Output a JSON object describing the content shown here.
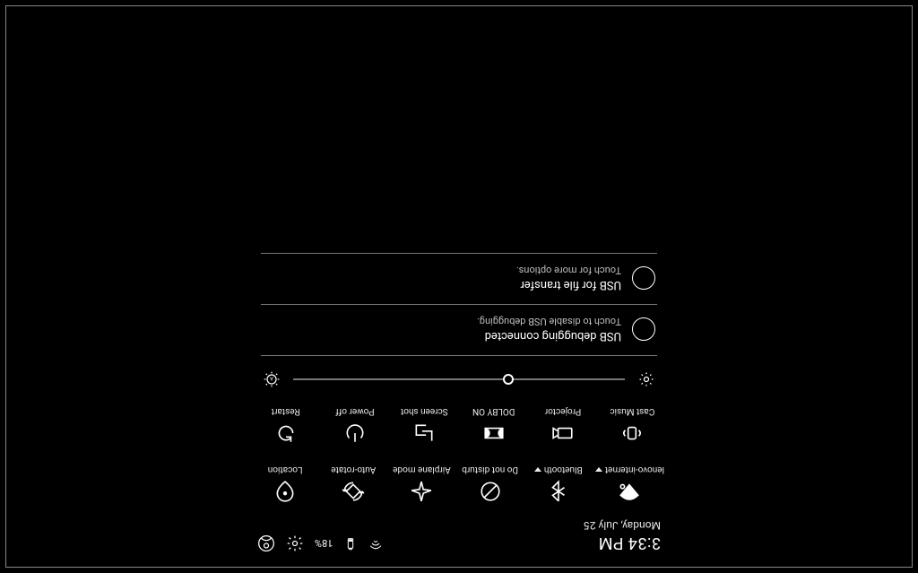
{
  "header": {
    "time": "3:34 PM",
    "date": "Monday, July 25",
    "battery": "18%"
  },
  "tiles_row1": [
    {
      "id": "wifi",
      "label": "lenovo-internet",
      "caret": true
    },
    {
      "id": "bluetooth",
      "label": "Bluetooth",
      "caret": true
    },
    {
      "id": "dnd",
      "label": "Do not disturb",
      "caret": false
    },
    {
      "id": "airplane",
      "label": "Airplane mode",
      "caret": false
    },
    {
      "id": "autorotate",
      "label": "Auto-rotate",
      "caret": false
    },
    {
      "id": "location",
      "label": "Location",
      "caret": false
    }
  ],
  "tiles_row2": [
    {
      "id": "castmusic",
      "label": "Cast Music",
      "caret": false
    },
    {
      "id": "projector",
      "label": "Projector",
      "caret": false
    },
    {
      "id": "dolby",
      "label": "DOLBY ON",
      "caret": false
    },
    {
      "id": "screenshot",
      "label": "Screen shot",
      "caret": false
    },
    {
      "id": "poweroff",
      "label": "Power off",
      "caret": false
    },
    {
      "id": "restart",
      "label": "Restart",
      "caret": false
    }
  ],
  "brightness": {
    "percent": 35
  },
  "notifications": [
    {
      "title": "USB debugging connected",
      "sub": "Touch to disable USB debugging."
    },
    {
      "title": "USB for file transfer",
      "sub": "Touch for more options."
    }
  ]
}
